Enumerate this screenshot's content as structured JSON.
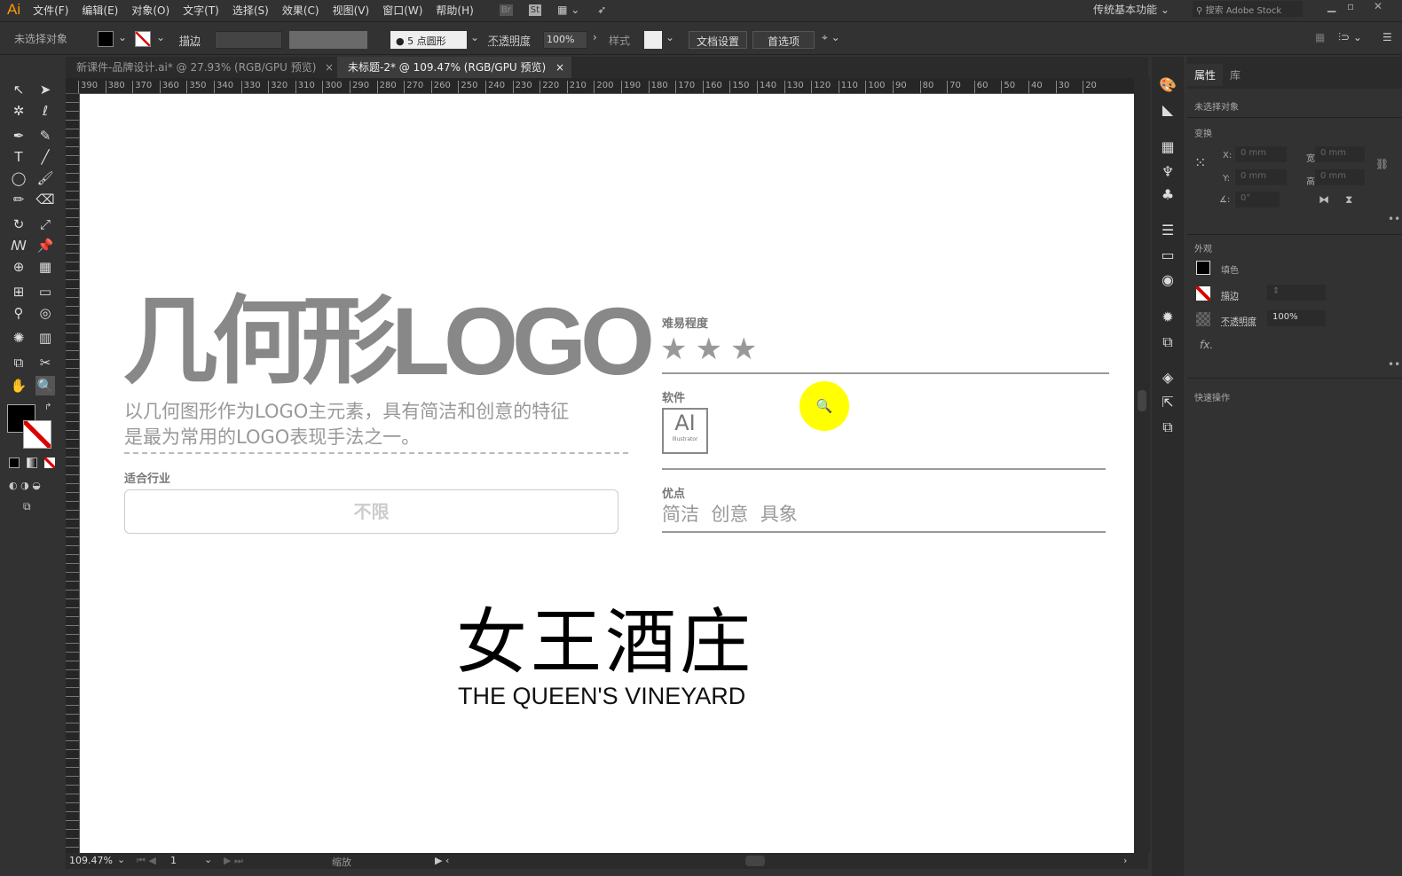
{
  "app": {
    "logo": "Ai"
  },
  "menu": [
    "文件(F)",
    "编辑(E)",
    "对象(O)",
    "文字(T)",
    "选择(S)",
    "效果(C)",
    "视图(V)",
    "窗口(W)",
    "帮助(H)"
  ],
  "menu_icons": {
    "br": "Br",
    "st": "St"
  },
  "workspace": "传统基本功能",
  "search_placeholder": "搜索 Adobe Stock",
  "control": {
    "no_selection": "未选择对象",
    "stroke_label": "描边",
    "brush": "5 点圆形",
    "opacity_label": "不透明度",
    "opacity": "100%",
    "style_label": "样式",
    "doc_setup": "文档设置",
    "prefs": "首选项"
  },
  "tabs": [
    {
      "label": "新课件-品牌设计.ai* @ 27.93% (RGB/GPU 预览)",
      "active": false
    },
    {
      "label": "未标题-2* @ 109.47% (RGB/GPU 预览)",
      "active": true
    }
  ],
  "ruler": [
    "390",
    "380",
    "370",
    "360",
    "350",
    "340",
    "330",
    "320",
    "310",
    "300",
    "290",
    "280",
    "270",
    "260",
    "250",
    "240",
    "230",
    "220",
    "210",
    "200",
    "190",
    "180",
    "170",
    "160",
    "150",
    "140",
    "130",
    "120",
    "110",
    "100",
    "90",
    "80",
    "70",
    "60",
    "50",
    "40",
    "30",
    "20"
  ],
  "artboard": {
    "title": "几何形LOGO",
    "desc1": "以几何图形作为LOGO主元素，具有简洁和创意的特征",
    "desc2": "是最为常用的LOGO表现手法之一。",
    "industry_label": "适合行业",
    "industry_value": "不限",
    "difficulty_label": "难易程度",
    "difficulty_stars": 3,
    "software_label": "软件",
    "software_icon": "AI",
    "software_icon_sub": "Illustrator",
    "merits_label": "优点",
    "merits": "简洁  创意  具象",
    "logo_cn": "女王酒庄",
    "logo_en": "THE QUEEN'S VINEYARD"
  },
  "status": {
    "zoom": "109.47%",
    "page": "1",
    "tool": "缩放"
  },
  "panel": {
    "tab_props": "属性",
    "tab_lib": "库",
    "no_selection": "未选择对象",
    "transform": "变换",
    "x": "X:",
    "y": "Y:",
    "w": "宽:",
    "h": "高:",
    "xval": "0 mm",
    "yval": "0 mm",
    "wval": "0 mm",
    "hval": "0 mm",
    "angle": "0°",
    "appearance": "外观",
    "fill": "填色",
    "stroke": "描边",
    "opacity_label": "不透明度",
    "opacity": "100%",
    "fx": "fx.",
    "quick": "快速操作"
  },
  "colors": {
    "accent": "#ff9a00",
    "cursor": "#ffff00",
    "text_gray": "#888888"
  }
}
